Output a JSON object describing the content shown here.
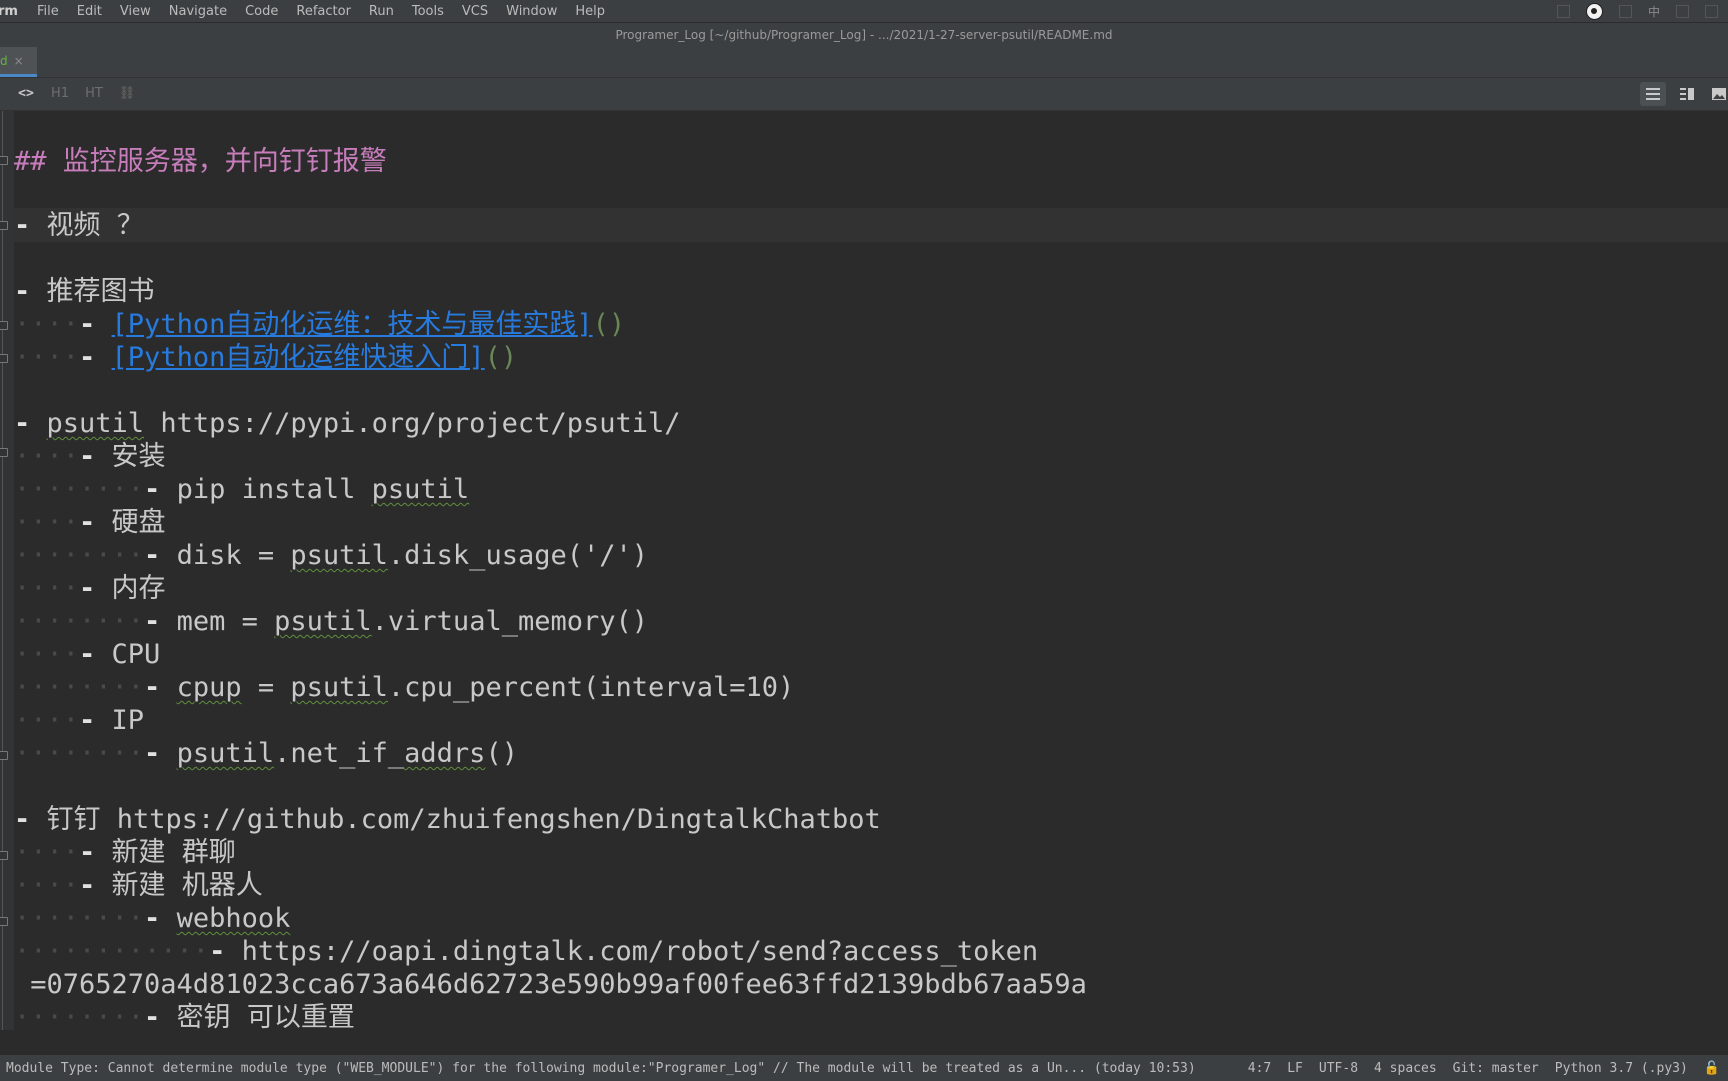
{
  "menubar": {
    "app": "rm",
    "items": [
      "File",
      "Edit",
      "View",
      "Navigate",
      "Code",
      "Refactor",
      "Run",
      "Tools",
      "VCS",
      "Window",
      "Help"
    ],
    "tray_ime": "中"
  },
  "titlebar": {
    "text": "Programer_Log [~/github/Programer_Log] - .../2021/1-27-server-psutil/README.md"
  },
  "tabs": [
    {
      "label": "d",
      "close": "×"
    }
  ],
  "toolbar": {
    "code": "<>",
    "h1": "H1",
    "ht": "HT",
    "link": "⛓"
  },
  "editor": {
    "l01": {
      "prefix": "## ",
      "text": "监控服务器，并向钉钉报警"
    },
    "l02": {
      "bullet": "- ",
      "text": "视频 ？"
    },
    "l03": {
      "bullet": "- ",
      "text": "推荐图书"
    },
    "l04": {
      "dots": "····",
      "bullet": "- ",
      "link": "[Python自动化运维：技术与最佳实践]",
      "paren": "()"
    },
    "l05": {
      "dots": "····",
      "bullet": "- ",
      "link": "[Python自动化运维快速入门]",
      "paren": "()"
    },
    "l06": {
      "bullet": "- ",
      "a": "psutil",
      "b": " https://pypi.org/project/psutil/"
    },
    "l07": {
      "dots": "····",
      "bullet": "- ",
      "text": "安装"
    },
    "l08": {
      "dots": "········",
      "bullet": "- ",
      "a": "pip install ",
      "b": "psutil"
    },
    "l09": {
      "dots": "····",
      "bullet": "- ",
      "text": "硬盘"
    },
    "l10": {
      "dots": "········",
      "bullet": "- ",
      "a": "disk = ",
      "b": "psutil",
      "c": ".disk_usage('/')"
    },
    "l11": {
      "dots": "····",
      "bullet": "- ",
      "text": "内存"
    },
    "l12": {
      "dots": "········",
      "bullet": "- ",
      "a": "mem = ",
      "b": "psutil",
      "c": ".virtual_memory()"
    },
    "l13": {
      "dots": "····",
      "bullet": "- ",
      "text": "CPU"
    },
    "l14": {
      "dots": "········",
      "bullet": "- ",
      "a": "cpup",
      "b": " = ",
      "c": "psutil",
      "d": ".cpu_percent(interval=10)"
    },
    "l15": {
      "dots": "····",
      "bullet": "- ",
      "text": "IP"
    },
    "l16": {
      "dots": "········",
      "bullet": "- ",
      "a": "psutil",
      "b": ".net_if_",
      "c": "addrs",
      "d": "()"
    },
    "l17": {
      "bullet": "- ",
      "text": "钉钉 https://github.com/zhuifengshen/DingtalkChatbot"
    },
    "l18": {
      "dots": "····",
      "bullet": "- ",
      "text": "新建 群聊"
    },
    "l19": {
      "dots": "····",
      "bullet": "- ",
      "text": "新建 机器人"
    },
    "l20": {
      "dots": "········",
      "bullet": "- ",
      "a": "webhook"
    },
    "l21": {
      "dots": "············",
      "bullet": "- ",
      "text": "https://oapi.dingtalk.com/robot/send?access_token"
    },
    "l22": {
      "text": " =0765270a4d81023cca673a646d62723e590b99af00fee63ffd2139bdb67aa59a"
    },
    "l23": {
      "dots": "········",
      "bullet": "- ",
      "text": "密钥 可以重置"
    }
  },
  "statusbar": {
    "message": "Module Type: Cannot determine module type (\"WEB_MODULE\") for the following module:\"Programer_Log\" // The module will be treated as a Un... (today 10:53)",
    "position": "4:7",
    "line_sep": "LF",
    "encoding": "UTF-8",
    "indent": "4 spaces",
    "vcs": "Git: master",
    "interpreter": "Python 3.7 (.py3)"
  }
}
